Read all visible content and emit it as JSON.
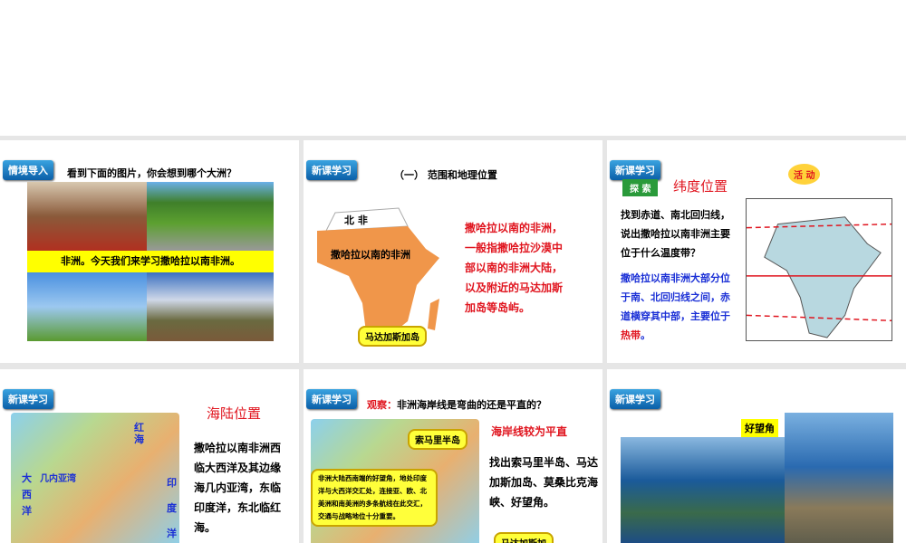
{
  "slides": [
    {
      "tag": "情境导入",
      "question": "看到下面的图片，你会想到哪个大洲？",
      "banner": "非洲。今天我们来学习撒哈拉以南非洲。"
    },
    {
      "tag": "新课学习",
      "title": "（一） 范围和地理位置",
      "map_north": "北 非",
      "map_south": "撒哈拉以南的非洲",
      "callout": "马达加斯加岛",
      "text": "撒哈拉以南的非洲，一般指撒哈拉沙漠中部以南的非洲大陆，以及附近的马达加斯加岛等岛屿。"
    },
    {
      "tag": "新课学习",
      "activity": "活 动",
      "explore": "探 索",
      "heading": "纬度位置",
      "question": "找到赤道、南北回归线，说出撒哈拉以南非洲主要位于什么温度带？",
      "answer": "撒哈拉以南非洲大部分位于南、北回归线之间，赤道横穿其中部，主要位于",
      "answer_hl": "热带",
      "answer_end": "。"
    },
    {
      "tag": "新课学习",
      "heading": "海陆位置",
      "labels": [
        "红海",
        "几内亚湾",
        "大西洋",
        "印度洋"
      ],
      "text": "撒哈拉以南非洲西临大西洋及其边缘海几内亚湾，东临印度洋，东北临红海。"
    },
    {
      "tag": "新课学习",
      "observe": "观察：",
      "question": "非洲海岸线是弯曲的还是平直的？",
      "answer": "海岸线较为平直",
      "callout_somali": "索马里半岛",
      "callout_cape": "非洲大陆西南端的好望角，地处印度洋与大西洋交汇处，连接亚、欧、北美洲和南美洲的多条航线在此交汇，交通与战略地位十分重要。",
      "callout_mada": "马达加斯加",
      "task": "找出索马里半岛、马达加斯加岛、莫桑比克海峡、好望角。"
    },
    {
      "tag": "新课学习",
      "photo_label": "好望角"
    }
  ]
}
